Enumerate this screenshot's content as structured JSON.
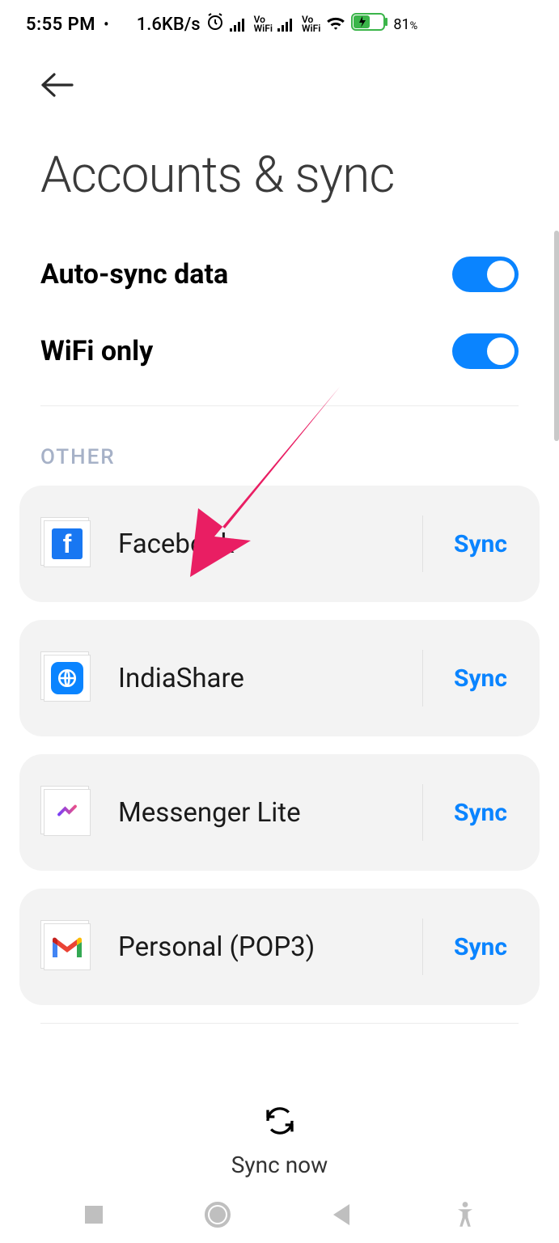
{
  "status": {
    "time": "5:55 PM",
    "dot": "•",
    "speed": "1.6KB/s",
    "vo": "Vo",
    "wifi_label": "WiFi",
    "battery_pct": "81",
    "pct_sym": "%"
  },
  "header": {
    "title": "Accounts & sync"
  },
  "toggles": {
    "auto_sync": {
      "label": "Auto-sync data",
      "on": true
    },
    "wifi_only": {
      "label": "WiFi only",
      "on": true
    }
  },
  "section_other": "OTHER",
  "accounts": [
    {
      "name": "Facebook",
      "action": "Sync",
      "icon": "facebook-icon"
    },
    {
      "name": "IndiaShare",
      "action": "Sync",
      "icon": "indiashare-icon"
    },
    {
      "name": "Messenger Lite",
      "action": "Sync",
      "icon": "messenger-lite-icon"
    },
    {
      "name": "Personal (POP3)",
      "action": "Sync",
      "icon": "gmail-icon"
    }
  ],
  "sync_now": "Sync now"
}
